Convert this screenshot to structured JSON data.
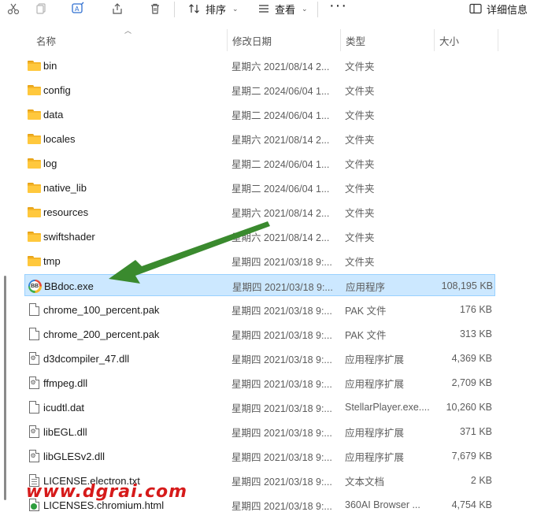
{
  "toolbar": {
    "sort_label": "排序",
    "view_label": "查看",
    "more_label": "···",
    "details_label": "详细信息"
  },
  "columns": {
    "name": "名称",
    "date": "修改日期",
    "type": "类型",
    "size": "大小"
  },
  "files": [
    {
      "name": "bin",
      "date": "星期六 2021/08/14 2...",
      "type": "文件夹",
      "size": "",
      "icon": "folder-icon"
    },
    {
      "name": "config",
      "date": "星期二 2024/06/04 1...",
      "type": "文件夹",
      "size": "",
      "icon": "folder-icon"
    },
    {
      "name": "data",
      "date": "星期二 2024/06/04 1...",
      "type": "文件夹",
      "size": "",
      "icon": "folder-icon"
    },
    {
      "name": "locales",
      "date": "星期六 2021/08/14 2...",
      "type": "文件夹",
      "size": "",
      "icon": "folder-icon"
    },
    {
      "name": "log",
      "date": "星期二 2024/06/04 1...",
      "type": "文件夹",
      "size": "",
      "icon": "folder-icon"
    },
    {
      "name": "native_lib",
      "date": "星期二 2024/06/04 1...",
      "type": "文件夹",
      "size": "",
      "icon": "folder-icon"
    },
    {
      "name": "resources",
      "date": "星期六 2021/08/14 2...",
      "type": "文件夹",
      "size": "",
      "icon": "folder-icon"
    },
    {
      "name": "swiftshader",
      "date": "星期六 2021/08/14 2...",
      "type": "文件夹",
      "size": "",
      "icon": "folder-icon"
    },
    {
      "name": "tmp",
      "date": "星期四 2021/03/18 9:...",
      "type": "文件夹",
      "size": "",
      "icon": "folder-icon"
    },
    {
      "name": "BBdoc.exe",
      "date": "星期四 2021/03/18 9:...",
      "type": "应用程序",
      "size": "108,195 KB",
      "icon": "bbdoc-app-icon",
      "selected": true
    },
    {
      "name": "chrome_100_percent.pak",
      "date": "星期四 2021/03/18 9:...",
      "type": "PAK 文件",
      "size": "176 KB",
      "icon": "file-icon"
    },
    {
      "name": "chrome_200_percent.pak",
      "date": "星期四 2021/03/18 9:...",
      "type": "PAK 文件",
      "size": "313 KB",
      "icon": "file-icon"
    },
    {
      "name": "d3dcompiler_47.dll",
      "date": "星期四 2021/03/18 9:...",
      "type": "应用程序扩展",
      "size": "4,369 KB",
      "icon": "dll-file-icon"
    },
    {
      "name": "ffmpeg.dll",
      "date": "星期四 2021/03/18 9:...",
      "type": "应用程序扩展",
      "size": "2,709 KB",
      "icon": "dll-file-icon"
    },
    {
      "name": "icudtl.dat",
      "date": "星期四 2021/03/18 9:...",
      "type": "StellarPlayer.exe....",
      "size": "10,260 KB",
      "icon": "file-icon"
    },
    {
      "name": "libEGL.dll",
      "date": "星期四 2021/03/18 9:...",
      "type": "应用程序扩展",
      "size": "371 KB",
      "icon": "dll-file-icon"
    },
    {
      "name": "libGLESv2.dll",
      "date": "星期四 2021/03/18 9:...",
      "type": "应用程序扩展",
      "size": "7,679 KB",
      "icon": "dll-file-icon"
    },
    {
      "name": "LICENSE.electron.txt",
      "date": "星期四 2021/03/18 9:...",
      "type": "文本文档",
      "size": "2 KB",
      "icon": "text-file-icon"
    },
    {
      "name": "LICENSES.chromium.html",
      "date": "星期四 2021/03/18 9:...",
      "type": "360AI Browser ...",
      "size": "4,754 KB",
      "icon": "html-file-icon"
    }
  ],
  "watermark": "www.dgrai.com",
  "colors": {
    "selection_bg": "#cce8ff",
    "selection_border": "#99d1ff",
    "arrow": "#3a8a2e",
    "watermark": "#d61a1a"
  }
}
